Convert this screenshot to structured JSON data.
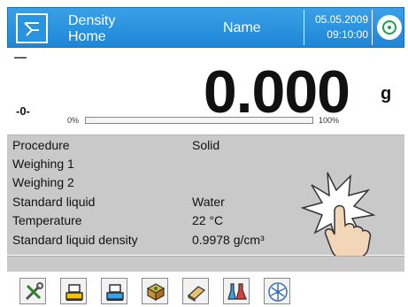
{
  "header": {
    "mode_line1": "Density",
    "mode_line2": "Home",
    "user_name": "Name",
    "date": "05.05.2009",
    "time": "09:10:00"
  },
  "reading": {
    "stable_mark": "—",
    "zero_mark": "-0-",
    "value": "0.000",
    "unit": "g",
    "bar_start_label": "0%",
    "bar_end_label": "100%",
    "bar_fill_fraction": 0.0
  },
  "info": {
    "rows": [
      {
        "label": "Procedure",
        "value": "Solid"
      },
      {
        "label": "Weighing 1",
        "value": ""
      },
      {
        "label": "Weighing 2",
        "value": ""
      },
      {
        "label": "Standard liquid",
        "value": "Water"
      },
      {
        "label": "Temperature",
        "value": "22 °C"
      },
      {
        "label": "Standard liquid density",
        "value": "0.9978 g/cm³"
      }
    ]
  },
  "toolbar": {
    "icons": [
      "tools-icon",
      "weighing-pan-icon",
      "weighing-pan-alt-icon",
      "box-icon",
      "eraser-icon",
      "lab-flasks-icon",
      "fan-icon"
    ]
  },
  "colors": {
    "header_blue": "#1e86d6",
    "panel_gray": "#c9c9c9",
    "level_green": "#1aa14a"
  }
}
